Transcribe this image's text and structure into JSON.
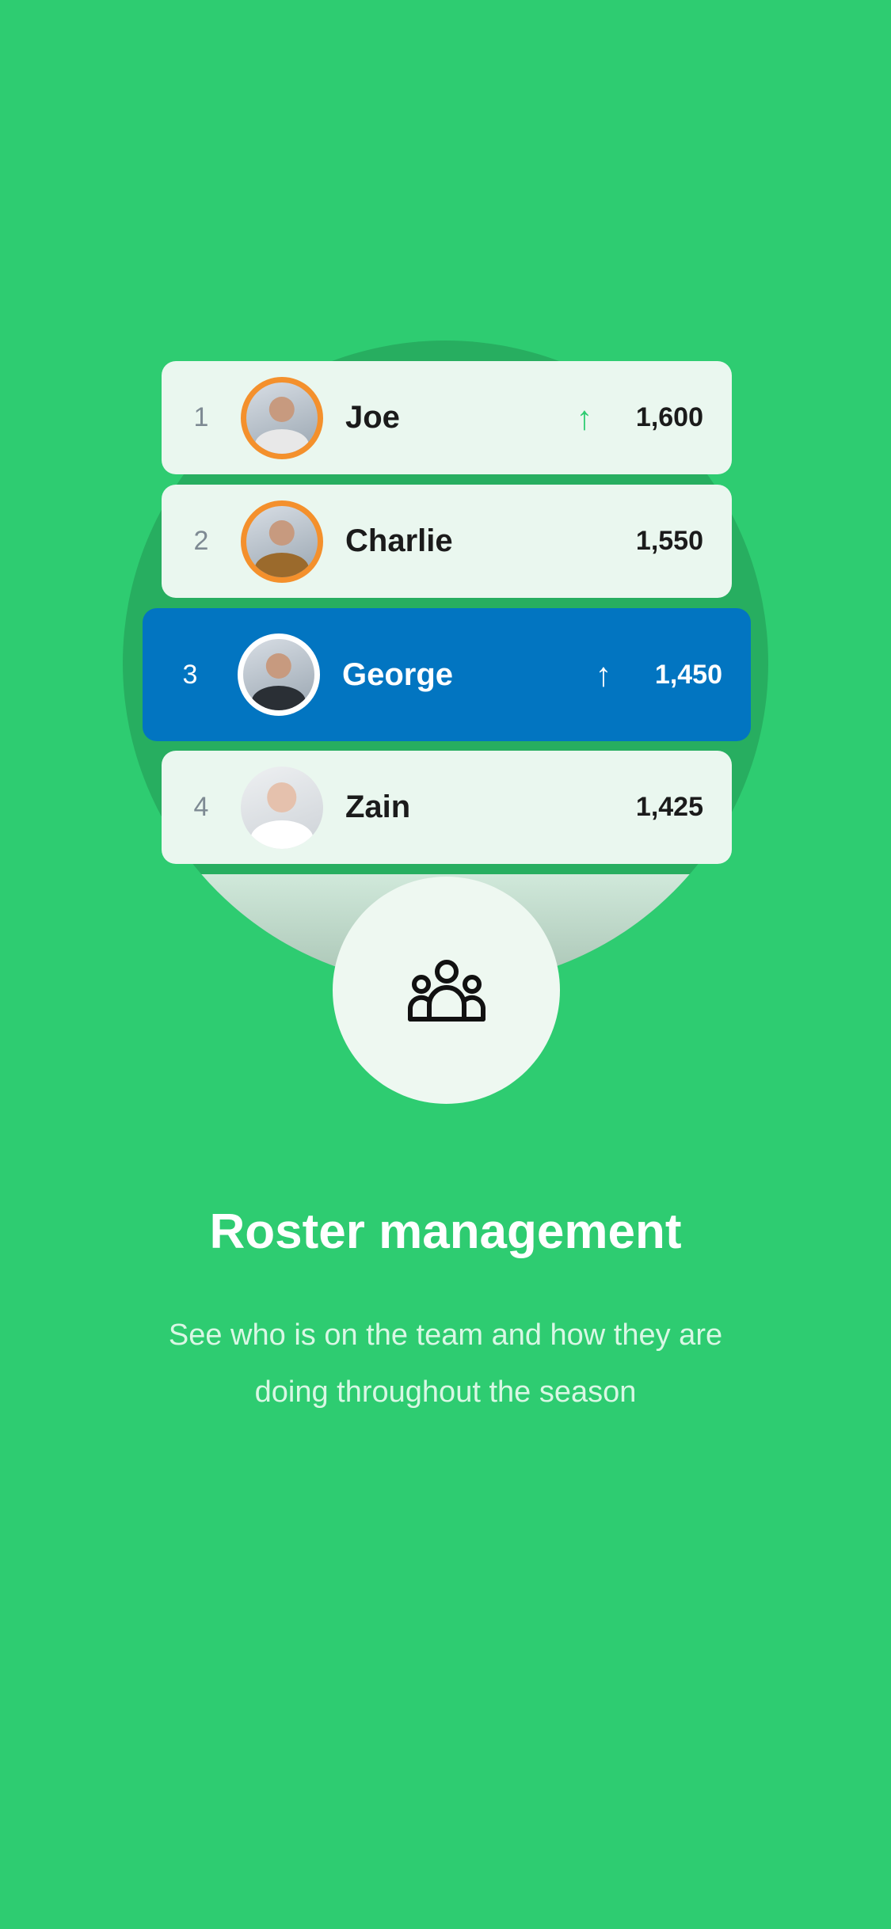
{
  "leaderboard": [
    {
      "rank": "1",
      "name": "Joe",
      "score": "1,600",
      "trend": "up"
    },
    {
      "rank": "2",
      "name": "Charlie",
      "score": "1,550",
      "trend": ""
    },
    {
      "rank": "3",
      "name": "George",
      "score": "1,450",
      "trend": "up"
    },
    {
      "rank": "4",
      "name": "Zain",
      "score": "1,425",
      "trend": ""
    }
  ],
  "arrow_glyph": "↑",
  "icon": "team-people-icon",
  "title": "Roster management",
  "subtitle": "See who is on the team and how they are doing throughout the season",
  "colors": {
    "background": "#2ECC71",
    "circle": "#27AE60",
    "row": "#EAF7EF",
    "highlight": "#0275C1",
    "avatar_ring": "#F4902C",
    "arrow_up": "#2ECC71"
  }
}
